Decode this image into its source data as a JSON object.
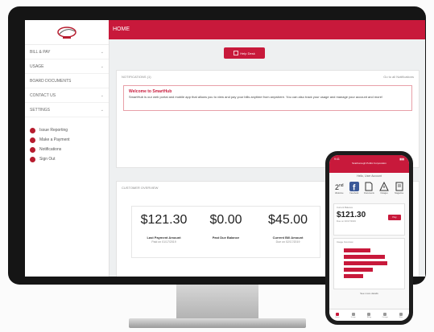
{
  "colors": {
    "brand": "#c8193b",
    "brand_dark": "#b71c2e",
    "bezel": "#151515"
  },
  "desktop": {
    "logo": {
      "line1": "Scarborough",
      "line2": "Public Utilities"
    },
    "header": {
      "title": "HOME"
    },
    "sidebar": {
      "items": [
        {
          "label": "BILL & PAY"
        },
        {
          "label": "USAGE"
        },
        {
          "label": "BOARD DOCUMENTS"
        },
        {
          "label": "CONTACT US"
        },
        {
          "label": "SETTINGS"
        }
      ],
      "actions": [
        {
          "label": "Issue Reporting"
        },
        {
          "label": "Make a Payment"
        },
        {
          "label": "Notifications"
        },
        {
          "label": "Sign Out"
        }
      ]
    },
    "cta": {
      "label": "Help Desk"
    },
    "notifications": {
      "title": "NOTIFICATIONS (1)",
      "link": "Go to all Notifications",
      "message_title": "Welcome to SmartHub",
      "message_text": "SmartHub is our web portal and mobile app that allows you to view and pay your bills anytime from anywhere. You can also track your usage and manage your account and more!"
    },
    "overview": {
      "title": "CUSTOMER OVERVIEW",
      "stats": [
        {
          "amount": "$121.30",
          "label": "Last Payment Amount",
          "sub": "Paid on 01/17/2019"
        },
        {
          "amount": "$0.00",
          "label": "Past Due Balance",
          "sub": ""
        },
        {
          "amount": "$45.00",
          "label": "Current Bill Amount",
          "sub": "Due on 02/17/2019"
        }
      ]
    }
  },
  "phone": {
    "time": "9:41",
    "header_title": "Scarborough Public Corporation",
    "subheader": "Hello, User Account",
    "icons": [
      {
        "label": "Welcome"
      },
      {
        "label": "Facebook"
      },
      {
        "label": "Documents"
      },
      {
        "label": "Outages"
      },
      {
        "label": "Magazine"
      }
    ],
    "card": {
      "label": "Current Balance",
      "amount": "$121.30",
      "sub": "Due on 02/17/2019",
      "pay": "Pay"
    },
    "usage_label": "Usage Overview",
    "usage_values": [
      0.55,
      0.85,
      0.9,
      0.6,
      0.4
    ],
    "more_link": "See more details",
    "tabs": [
      {
        "label": "Home"
      },
      {
        "label": "Usage"
      },
      {
        "label": "Billing"
      },
      {
        "label": "Outages"
      },
      {
        "label": "More"
      }
    ]
  }
}
